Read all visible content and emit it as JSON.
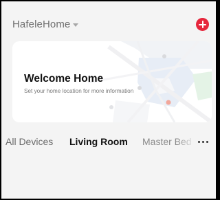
{
  "header": {
    "home_name": "HafeleHome",
    "dropdown_icon": "caret-down-icon",
    "add_icon": "plus-circle-icon",
    "add_color": "#e6263c"
  },
  "welcome_card": {
    "title": "Welcome Home",
    "subtitle": "Set your home location for more information"
  },
  "rooms": {
    "tabs": [
      {
        "label": "All Devices",
        "active": false
      },
      {
        "label": "Living Room",
        "active": true
      },
      {
        "label": "Master Bedroom",
        "active": false
      }
    ],
    "more_icon": "more-horizontal-icon"
  },
  "colors": {
    "background": "#f4f4f4",
    "accent": "#e6263c",
    "card": "#ffffff"
  }
}
